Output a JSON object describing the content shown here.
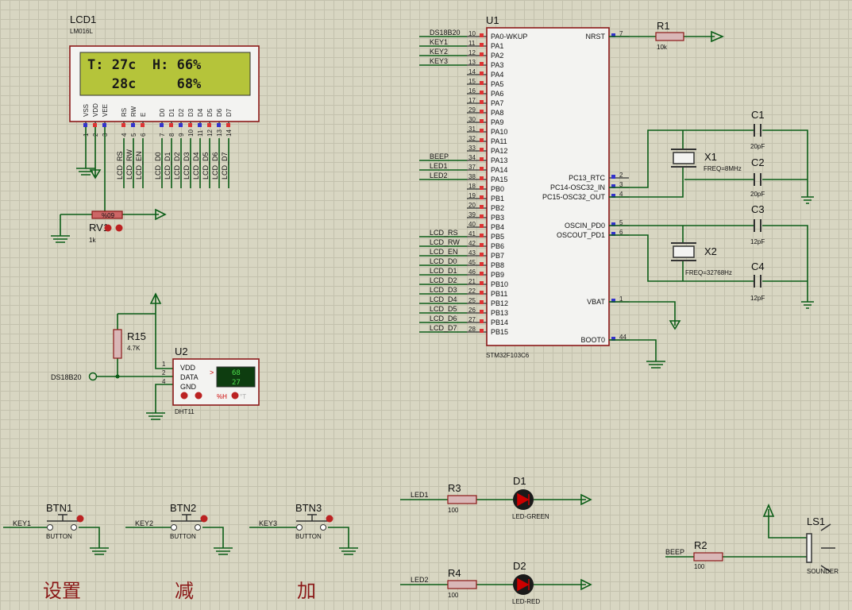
{
  "lcd": {
    "ref": "LCD1",
    "model": "LM016L",
    "line1": "T: 27c  H: 66%",
    "line2": "   28c     68%",
    "pins": [
      "VSS",
      "VDD",
      "VEE",
      "RS",
      "RW",
      "E",
      "D0",
      "D1",
      "D2",
      "D3",
      "D4",
      "D5",
      "D6",
      "D7"
    ],
    "pin_numbers": [
      "1",
      "2",
      "3",
      "4",
      "5",
      "6",
      "7",
      "8",
      "9",
      "10",
      "11",
      "12",
      "13",
      "14"
    ],
    "nets": [
      "LCD_RS",
      "LCD_RW",
      "LCD_EN",
      "LCD_D0",
      "LCD_D1",
      "LCD_D2",
      "LCD_D3",
      "LCD_D4",
      "LCD_D5",
      "LCD_D6",
      "LCD_D7"
    ]
  },
  "rv1": {
    "ref": "RV1",
    "value": "1k",
    "pct": "%09"
  },
  "u1": {
    "ref": "U1",
    "part": "STM32F103C6",
    "left_pins": [
      [
        "10",
        "PA0-WKUP",
        "DS18B20"
      ],
      [
        "11",
        "PA1",
        "KEY1"
      ],
      [
        "12",
        "PA2",
        "KEY2"
      ],
      [
        "13",
        "PA3",
        "KEY3"
      ],
      [
        "14",
        "PA4",
        ""
      ],
      [
        "15",
        "PA5",
        ""
      ],
      [
        "16",
        "PA6",
        ""
      ],
      [
        "17",
        "PA7",
        ""
      ],
      [
        "29",
        "PA8",
        ""
      ],
      [
        "30",
        "PA9",
        ""
      ],
      [
        "31",
        "PA10",
        ""
      ],
      [
        "32",
        "PA11",
        ""
      ],
      [
        "33",
        "PA12",
        ""
      ],
      [
        "34",
        "PA13",
        "BEEP"
      ],
      [
        "37",
        "PA14",
        "LED1"
      ],
      [
        "38",
        "PA15",
        "LED2"
      ],
      [
        "18",
        "PB0",
        ""
      ],
      [
        "19",
        "PB1",
        ""
      ],
      [
        "20",
        "PB2",
        ""
      ],
      [
        "39",
        "PB3",
        ""
      ],
      [
        "40",
        "PB4",
        ""
      ],
      [
        "41",
        "PB5",
        "LCD_RS"
      ],
      [
        "42",
        "PB6",
        "LCD_RW"
      ],
      [
        "43",
        "PB7",
        "LCD_EN"
      ],
      [
        "45",
        "PB8",
        "LCD_D0"
      ],
      [
        "46",
        "PB9",
        "LCD_D1"
      ],
      [
        "21",
        "PB10",
        "LCD_D2"
      ],
      [
        "22",
        "PB11",
        "LCD_D3"
      ],
      [
        "25",
        "PB12",
        "LCD_D4"
      ],
      [
        "26",
        "PB13",
        "LCD_D5"
      ],
      [
        "27",
        "PB14",
        "LCD_D6"
      ],
      [
        "28",
        "PB15",
        "LCD_D7"
      ]
    ],
    "right_pins": [
      [
        "7",
        "NRST"
      ],
      [
        "2",
        "PC13_RTC"
      ],
      [
        "3",
        "PC14-OSC32_IN"
      ],
      [
        "4",
        "PC15-OSC32_OUT"
      ],
      [
        "5",
        "OSCIN_PD0"
      ],
      [
        "6",
        "OSCOUT_PD1"
      ],
      [
        "1",
        "VBAT"
      ],
      [
        "44",
        "BOOT0"
      ]
    ]
  },
  "r1": {
    "ref": "R1",
    "value": "10k"
  },
  "c1": {
    "ref": "C1",
    "value": "20pF"
  },
  "c2": {
    "ref": "C2",
    "value": "20pF"
  },
  "c3": {
    "ref": "C3",
    "value": "12pF"
  },
  "c4": {
    "ref": "C4",
    "value": "12pF"
  },
  "x1": {
    "ref": "X1",
    "value": "FREQ=8MHz"
  },
  "x2": {
    "ref": "X2",
    "value": "FREQ=32768Hz"
  },
  "r15": {
    "ref": "R15",
    "value": "4.7K"
  },
  "u2": {
    "ref": "U2",
    "part": "DHT11",
    "pins": [
      "VDD",
      "DATA",
      "GND"
    ],
    "pin_numbers": [
      "1",
      "2",
      "4"
    ],
    "net": "DS18B20",
    "display_h": "68",
    "display_t": "27",
    "h_label": "%H",
    "t_label": "°T",
    "arrow": ">"
  },
  "buttons": [
    {
      "ref": "BTN1",
      "net": "KEY1",
      "type": "BUTTON",
      "caption": "设置"
    },
    {
      "ref": "BTN2",
      "net": "KEY2",
      "type": "BUTTON",
      "caption": "减"
    },
    {
      "ref": "BTN3",
      "net": "KEY3",
      "type": "BUTTON",
      "caption": "加"
    }
  ],
  "r3": {
    "ref": "R3",
    "value": "100",
    "net": "LED1"
  },
  "r4": {
    "ref": "R4",
    "value": "100",
    "net": "LED2"
  },
  "d1": {
    "ref": "D1",
    "part": "LED-GREEN"
  },
  "d2": {
    "ref": "D2",
    "part": "LED-RED"
  },
  "r2": {
    "ref": "R2",
    "value": "100",
    "net": "BEEP"
  },
  "ls1": {
    "ref": "LS1",
    "part": "SOUNDER"
  },
  "colors": {
    "wire": "#0b5d17",
    "body": "#8b1818",
    "lcd_screen": "#b5c43a",
    "led_green": "#1f7a1f",
    "led_red": "#b01010"
  }
}
